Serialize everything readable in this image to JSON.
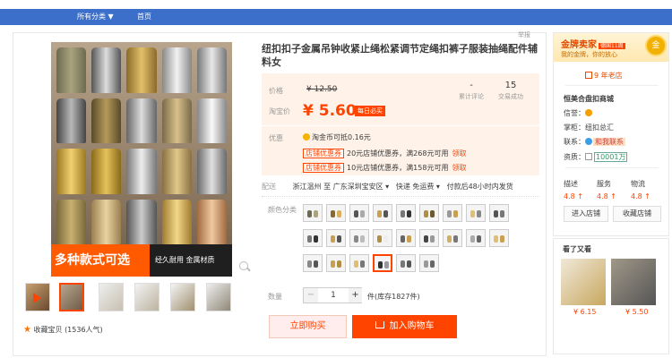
{
  "topnav": {
    "all_categories": "所有分类 ▼",
    "home": "首页"
  },
  "report": "举报",
  "product": {
    "title": "纽扣扣子金属吊钟收紧止绳松紧调节定绳扣裤子服装抽绳配件辅料女",
    "hero_tag": "多种款式可选",
    "hero_sub": "经久耐用 金属材质",
    "favorite_label": "收藏宝贝",
    "favorite_count": "(1536人气)"
  },
  "price": {
    "price_label": "价格",
    "original": "¥ 12.50",
    "promo_label": "淘宝价",
    "current": "¥ 5.60",
    "badge": "每日必买",
    "reviews_value": "-",
    "reviews_label": "累计评论",
    "sales_value": "15",
    "sales_label": "交易成功"
  },
  "promo": {
    "label": "优惠",
    "coin_text": "淘金币可抵0.16元",
    "coupons": [
      {
        "tag": "店铺优惠券",
        "text": "20元店铺优惠券，满268元可用",
        "get": "领取"
      },
      {
        "tag": "店铺优惠券",
        "text": "10元店铺优惠券，满158元可用",
        "get": "领取"
      }
    ]
  },
  "shipping": {
    "label": "配送",
    "from": "浙江温州 至",
    "to": "广东深圳宝安区 ▾",
    "fee": "快递 免运费 ▾",
    "time": "付款后48小时内发货"
  },
  "colors_label": "颜色分类",
  "quantity": {
    "label": "数量",
    "minus": "−",
    "value": "1",
    "plus": "+",
    "stock": "件(库存1827件)"
  },
  "buttons": {
    "buy_now": "立即购买",
    "add_to_cart": "加入购物车"
  },
  "shop": {
    "gold_title": "金牌卖家",
    "gold_level": "德国11周",
    "gold_sub": "我的金牌，你的放心",
    "medal": "金",
    "years": "9 年老店",
    "name": "恒美合盘扣商城",
    "credit_label": "信誉：",
    "keeper_label": "掌柜：",
    "keeper_value": "纽扣总汇",
    "contact_label": "联系：",
    "contact_value": "和我联系",
    "qual_label": "资质：",
    "qual_value": "10001万",
    "ratings": [
      {
        "label": "描述",
        "value": "4.8 ↑"
      },
      {
        "label": "服务",
        "value": "4.8 ↑"
      },
      {
        "label": "物流",
        "value": "4.8 ↑"
      }
    ],
    "enter_shop": "进入店铺",
    "fav_shop": "收藏店铺"
  },
  "also_viewed": {
    "heading": "看了又看",
    "items": [
      {
        "price": "¥ 6.15"
      },
      {
        "price": "¥ 5.50"
      }
    ]
  },
  "colors": {
    "brand_blue": "#3b6fc9",
    "accent": "#ff4400",
    "price_bg": "#fff2e8"
  }
}
